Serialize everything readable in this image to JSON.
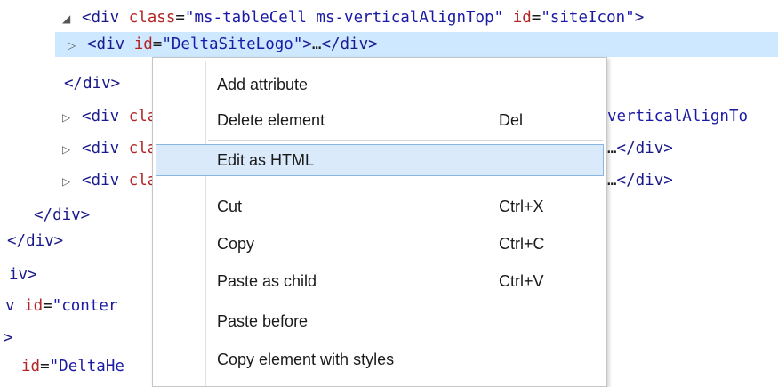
{
  "code_lines": [
    {
      "tri": "◢",
      "parts": [
        {
          "t": "<div ",
          "c": "tag"
        },
        {
          "t": "class",
          "c": "attr"
        },
        {
          "t": "=",
          "c": "plain"
        },
        {
          "t": "\"ms-tableCell ms-verticalAlignTop\"",
          "c": "val"
        },
        {
          "t": " ",
          "c": "plain"
        },
        {
          "t": "id",
          "c": "attr"
        },
        {
          "t": "=",
          "c": "plain"
        },
        {
          "t": "\"siteIcon\"",
          "c": "val"
        },
        {
          "t": ">",
          "c": "tag"
        }
      ]
    },
    {
      "tri": "▷",
      "parts": [
        {
          "t": "<div ",
          "c": "tag"
        },
        {
          "t": "id",
          "c": "attr"
        },
        {
          "t": "=",
          "c": "plain"
        },
        {
          "t": "\"DeltaSiteLogo\"",
          "c": "val"
        },
        {
          "t": ">",
          "c": "tag"
        },
        {
          "t": "…",
          "c": "plain"
        },
        {
          "t": "</div>",
          "c": "tag"
        }
      ]
    },
    {
      "tri": "",
      "parts": [
        {
          "t": "</div>",
          "c": "tag"
        }
      ]
    },
    {
      "tri": "▷",
      "parts": [
        {
          "t": "<div ",
          "c": "tag"
        },
        {
          "t": "cla",
          "c": "attr"
        }
      ],
      "tail": [
        {
          "t": "verticalAlignTo",
          "c": "val"
        }
      ]
    },
    {
      "tri": "▷",
      "parts": [
        {
          "t": "<div ",
          "c": "tag"
        },
        {
          "t": "cla",
          "c": "attr"
        }
      ],
      "tail": [
        {
          "t": "…",
          "c": "plain"
        },
        {
          "t": "</div>",
          "c": "tag"
        }
      ]
    },
    {
      "tri": "▷",
      "parts": [
        {
          "t": "<div ",
          "c": "tag"
        },
        {
          "t": "cla",
          "c": "attr"
        }
      ],
      "tail": [
        {
          "t": "…",
          "c": "plain"
        },
        {
          "t": "</div>",
          "c": "tag"
        }
      ]
    },
    {
      "tri": "",
      "parts": [
        {
          "t": "</div>",
          "c": "tag"
        }
      ]
    },
    {
      "tri": "",
      "parts": [
        {
          "t": "</div>",
          "c": "tag"
        }
      ]
    },
    {
      "tri": "",
      "parts": [
        {
          "t": "iv>",
          "c": "tag"
        }
      ]
    },
    {
      "tri": "",
      "parts": [
        {
          "t": "v ",
          "c": "tag"
        },
        {
          "t": "id",
          "c": "attr"
        },
        {
          "t": "=",
          "c": "plain"
        },
        {
          "t": "\"conter",
          "c": "val"
        }
      ]
    },
    {
      "tri": "",
      "parts": [
        {
          "t": ">",
          "c": "tag"
        }
      ]
    },
    {
      "tri": "",
      "parts": [
        {
          "t": "id",
          "c": "attr"
        },
        {
          "t": "=",
          "c": "plain"
        },
        {
          "t": "\"DeltaHe",
          "c": "val"
        }
      ]
    }
  ],
  "context_menu": {
    "items": [
      {
        "label": "Add attribute",
        "shortcut": ""
      },
      {
        "label": "Delete element",
        "shortcut": "Del"
      },
      {
        "label": "Edit as HTML",
        "shortcut": ""
      },
      {
        "label": "Cut",
        "shortcut": "Ctrl+X"
      },
      {
        "label": "Copy",
        "shortcut": "Ctrl+C"
      },
      {
        "label": "Paste as child",
        "shortcut": "Ctrl+V"
      },
      {
        "label": "Paste before",
        "shortcut": ""
      },
      {
        "label": "Copy element with styles",
        "shortcut": ""
      }
    ],
    "hovered_index": 2
  },
  "colors": {
    "tag": "#1a1a8c",
    "attribute": "#b32626",
    "value": "#1a1aa6",
    "selection": "#cde8ff",
    "menu_hover": "#dbeafa"
  }
}
